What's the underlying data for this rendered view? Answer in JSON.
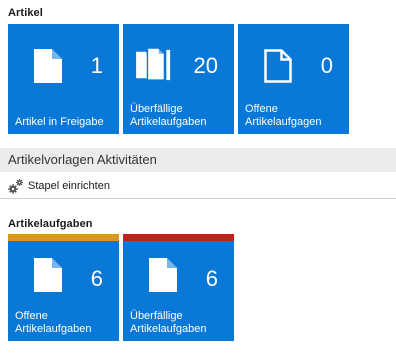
{
  "articles_section": {
    "title": "Artikel",
    "tiles": [
      {
        "count": "1",
        "label": "Artikel in Freigabe",
        "icon": "document-icon"
      },
      {
        "count": "20",
        "label": "Überfällige Artikelaufgaben",
        "icon": "documents-stack-icon"
      },
      {
        "count": "0",
        "label": "Offene Artikelaufgagen",
        "icon": "document-outline-icon"
      }
    ]
  },
  "activities": {
    "title": "Artikelvorlagen Aktivitäten",
    "action_label": "Stapel einrichten",
    "action_icon": "gears-icon"
  },
  "tasks_section": {
    "title": "Artikelaufgaben",
    "tiles": [
      {
        "count": "6",
        "label": "Offene Artikelaufgaben",
        "accent": "#d99a12",
        "icon": "document-icon"
      },
      {
        "count": "6",
        "label": "Überfällige Artikelaufgaben",
        "accent": "#c0211b",
        "icon": "document-icon"
      }
    ]
  },
  "colors": {
    "tile": "#0a78d6",
    "warning_accent": "#d99a12",
    "danger_accent": "#c0211b"
  }
}
